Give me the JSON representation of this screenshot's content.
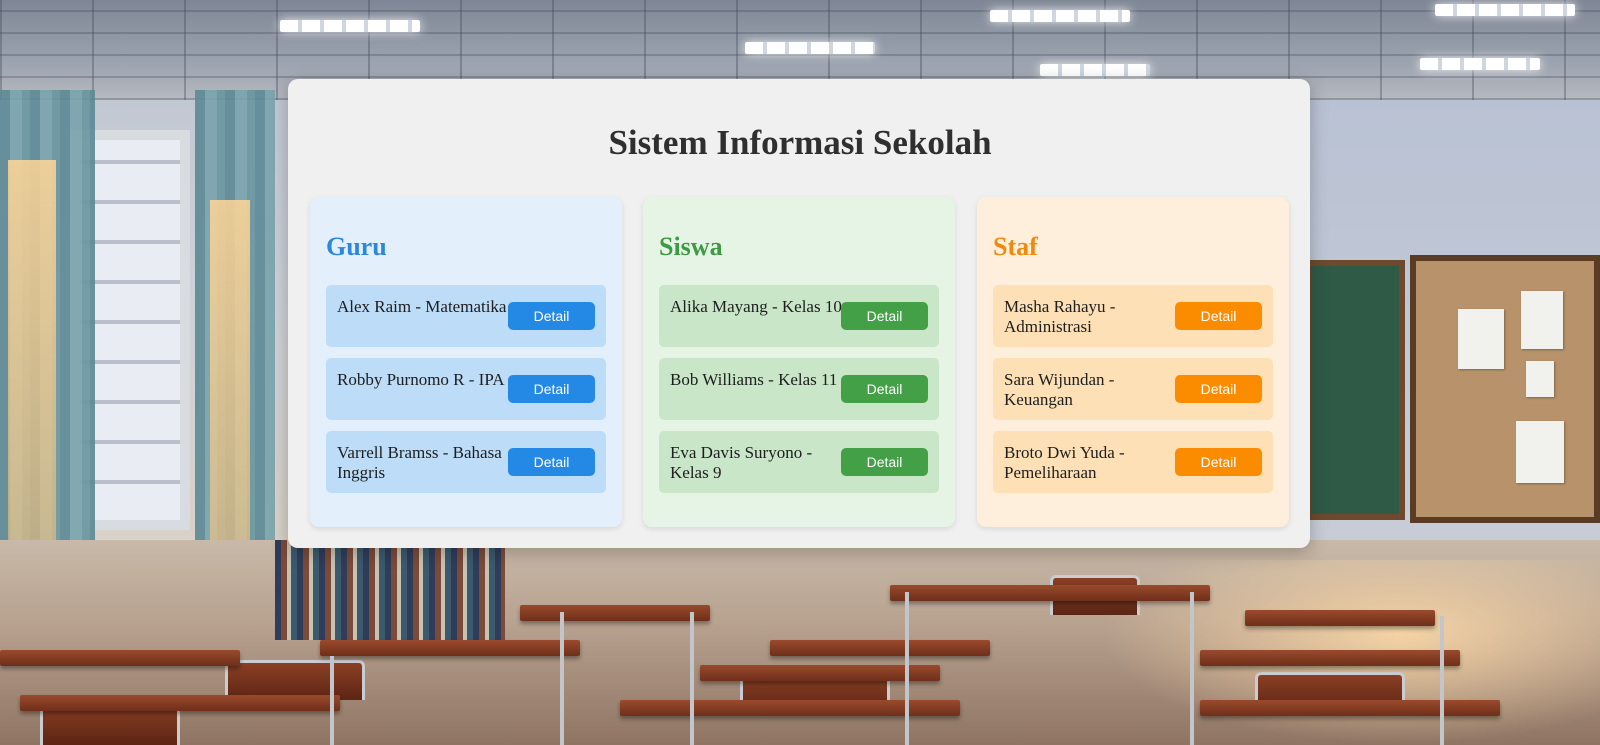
{
  "page": {
    "title": "Sistem Informasi Sekolah"
  },
  "sections": [
    {
      "heading": "Guru",
      "accent": "#2d88dc",
      "button_color": "#2489e4",
      "items": [
        {
          "text": "Alex Raim - Matematika",
          "button": "Detail"
        },
        {
          "text": "Robby Purnomo R - IPA",
          "button": "Detail"
        },
        {
          "text": "Varrell Bramss - Bahasa Inggris",
          "button": "Detail"
        }
      ]
    },
    {
      "heading": "Siswa",
      "accent": "#3e9a45",
      "button_color": "#43a047",
      "items": [
        {
          "text": "Alika Mayang - Kelas 10",
          "button": "Detail"
        },
        {
          "text": "Bob Williams - Kelas 11",
          "button": "Detail"
        },
        {
          "text": "Eva Davis Suryono - Kelas 9",
          "button": "Detail"
        }
      ]
    },
    {
      "heading": "Staf",
      "accent": "#f08a0c",
      "button_color": "#fb8c00",
      "items": [
        {
          "text": "Masha Rahayu - Administrasi",
          "button": "Detail"
        },
        {
          "text": "Sara Wijundan - Keuangan",
          "button": "Detail"
        },
        {
          "text": "Broto Dwi Yuda - Pemeliharaan",
          "button": "Detail"
        }
      ]
    }
  ]
}
